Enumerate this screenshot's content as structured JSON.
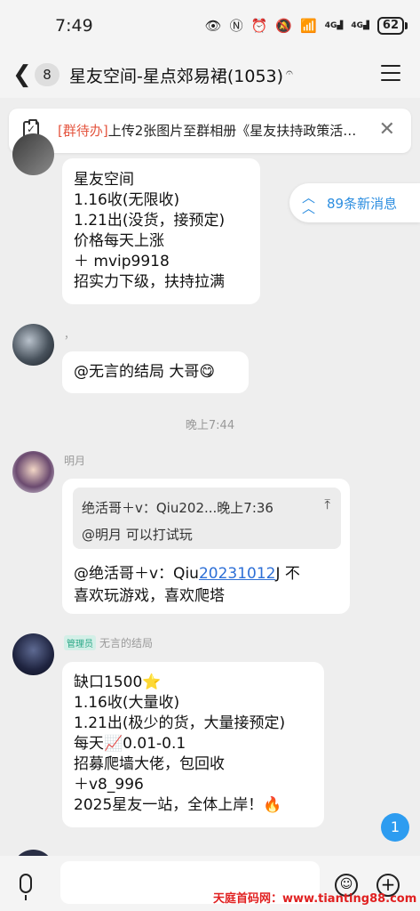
{
  "status_bar": {
    "time": "7:49",
    "battery": "62"
  },
  "nav": {
    "unread_count": "8",
    "title": "星友空间-星点郊易裙(1053)"
  },
  "todo": {
    "tag": "[群待办]",
    "text": "上传2张图片至群相册《星友扶持政策活…"
  },
  "new_messages": {
    "label": "89条新消息"
  },
  "messages": [
    {
      "lines": [
        "星友空间",
        "1.16收(无限收)",
        "1.21出(没货，接预定)",
        "价格每天上涨",
        "＋ mvip9918",
        "招实力下级，扶持拉满"
      ]
    },
    {
      "sender": "，",
      "lines": [
        "@无言的结局 大哥😋"
      ]
    },
    {
      "sender": "明月",
      "quote_line1": "绝活哥＋v：Qiu202...晚上7:36",
      "quote_line2": "@明月 可以打试玩",
      "text_prefix": "@绝活哥＋v：Qiu",
      "link": "20231012",
      "text_suffix": "J 不",
      "line2": "喜欢玩游戏，喜欢爬塔"
    },
    {
      "badge": "管理员",
      "sender": "无言的结局",
      "lines": [
        "缺口1500⭐",
        "1.16收(大量收)",
        "1.21出(极少的货，大量接预定)",
        "每天📈0.01-0.1",
        "招募爬墙大佬，包回收",
        "＋v8_996",
        "2025星友一站，全体上岸！🔥"
      ]
    }
  ],
  "time_divider": "晚上7:44",
  "unread_badge": "1",
  "watermark": "天庭首码网：www.tianting88.com"
}
